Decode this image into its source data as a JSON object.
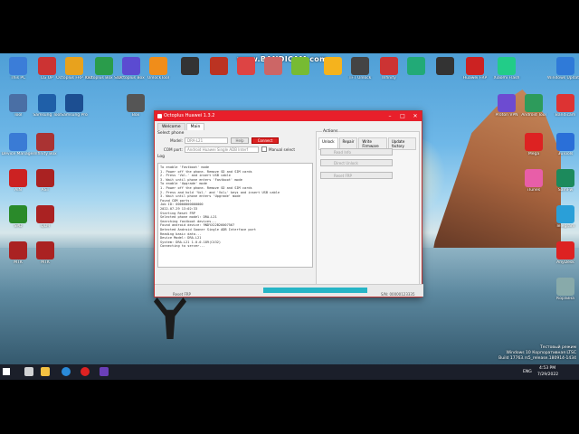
{
  "overlay": {
    "recorder_watermark": "www.BANDICAM.com"
  },
  "desktop_icons": [
    {
      "label": "This PC",
      "color": "#3b7dd8"
    },
    {
      "label": "LG UP",
      "color": "#c33"
    },
    {
      "label": "Octoplus FRP Tool",
      "color": "#e8a21d"
    },
    {
      "label": "Octoplus Box Samsung",
      "color": "#2a9c4b"
    },
    {
      "label": "Octoplus Box",
      "color": "#5b4bd1"
    },
    {
      "label": "UnlockTool",
      "color": "#f08d1a"
    },
    {
      "label": "",
      "color": "#333"
    },
    {
      "label": "",
      "color": "#b32"
    },
    {
      "label": "",
      "color": "#d44"
    },
    {
      "label": "",
      "color": "#c66"
    },
    {
      "label": "",
      "color": "#7b3"
    },
    {
      "label": "",
      "color": "#f5b31d"
    },
    {
      "label": "TFT Unlock",
      "color": "#444"
    },
    {
      "label": "Infinity",
      "color": "#c33"
    },
    {
      "label": "",
      "color": "#2a7"
    },
    {
      "label": "",
      "color": "#333"
    },
    {
      "label": "Huawei FRP",
      "color": "#c22"
    },
    {
      "label": "Xiaomi Flash",
      "color": "#2c8"
    },
    {
      "label": "Windows Update Mini",
      "color": "#2f7ad8"
    },
    {
      "label": "Tool",
      "color": "#4a6fa5"
    },
    {
      "label": "Samsung Tool",
      "color": "#1f5fa8"
    },
    {
      "label": "Samsung Pro",
      "color": "#1c4e91"
    },
    {
      "label": "Box",
      "color": "#555"
    },
    {
      "label": "Proton VPN",
      "color": "#6d4bd1"
    },
    {
      "label": "Android Tool",
      "color": "#2d9b5b"
    },
    {
      "label": "Bandicam",
      "color": "#d33"
    },
    {
      "label": "Device Manager",
      "color": "#3a7bd5"
    },
    {
      "label": "Infinity Box",
      "color": "#a33"
    },
    {
      "label": "AIN",
      "color": "#c22"
    },
    {
      "label": "AST",
      "color": "#a22"
    },
    {
      "label": "SPD",
      "color": "#2a8a2a"
    },
    {
      "label": "QLM",
      "color": "#a22"
    },
    {
      "label": "MTK",
      "color": "#a22"
    },
    {
      "label": "MTK",
      "color": "#a22"
    },
    {
      "label": "Mega",
      "color": "#d22"
    },
    {
      "label": "3uTools",
      "color": "#2a6fd8"
    },
    {
      "label": "iTunes",
      "color": "#e85ea8"
    },
    {
      "label": "SamFw",
      "color": "#1c8a5c"
    },
    {
      "label": "Telegram",
      "color": "#2a9fd8"
    },
    {
      "label": "AnyDesk",
      "color": "#d22"
    },
    {
      "label": "Корзина",
      "color": "#8aa"
    }
  ],
  "window": {
    "title": "Octoplus Huawei 1.3.2",
    "tabs": [
      "Welcome",
      "Main"
    ],
    "select_phone_label": "Select phone",
    "model_label": "Model:",
    "model_value": "DRA-L21",
    "help_button": "Help",
    "connect_button": "Connect",
    "port_label": "COM port:",
    "port_value": "Android Huawei Single ADB Interf",
    "manual_select": "Manual select",
    "log_label": "Log",
    "log_lines": [
      "To enable 'Fastboot' mode",
      "1. Power off the phone. Remove SD and SIM cards",
      "2. Press 'Vol-' and insert USB cable",
      "3. Wait until phone enters 'Fastboot' mode",
      "",
      "To enable 'Upgrade' mode",
      "1. Power off the phone. Remove SD and SIM cards",
      "2. Press and hold 'Vol-' and 'Vol+' keys and insert USB cable",
      "3. Wait until phone enters 'Upgrade' mode",
      "",
      "Found COM ports:",
      "",
      "Job ID: 00000000000000",
      "2022-07-29 13:02:33",
      "Starting Reset FRP",
      "Selected phone model: DRA-L21",
      "Searching fastboot devices...",
      "Found android device: 9NDYX22B26007567",
      "Detected Android Sooner Single ADB Interface port",
      "Reading basic data...",
      "Device Model: DRA-L21",
      "System: DRA-L21 1.0.0.189(C432)",
      "Connecting to server..."
    ],
    "actions_label": "Actions",
    "action_tabs": [
      "Unlock",
      "Repair",
      "Write Firmware",
      "Update factory"
    ],
    "action_buttons": [
      "Read Info",
      "Direct Unlock",
      "Reset FRP"
    ],
    "status_left": "Reset FRP",
    "status_right": "S/N: 00000123335",
    "progress": 1.0
  },
  "taskbar": {
    "lang": "ENG",
    "time": "4:53 PM",
    "date": "7/29/2022"
  },
  "os_watermark": {
    "line1": "Тестовый режим",
    "line2": "Windows 10 Корпоративная LTSC",
    "line3": "Build 17763.rs5_release.180914-1434"
  }
}
